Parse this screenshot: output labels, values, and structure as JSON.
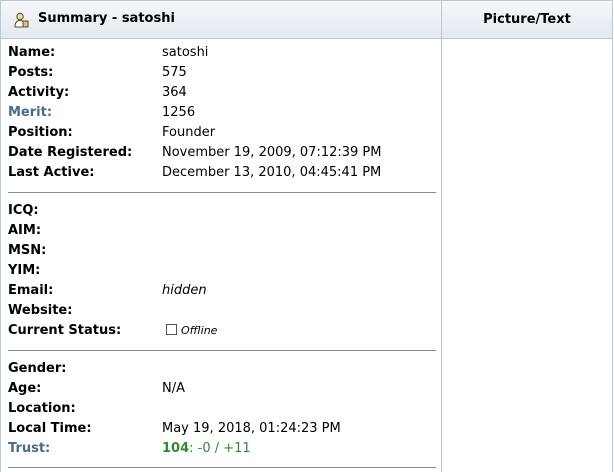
{
  "header": {
    "title": "Summary - satoshi",
    "right_title": "Picture/Text"
  },
  "summary": {
    "name": {
      "label": "Name:",
      "value": "satoshi"
    },
    "posts": {
      "label": "Posts:",
      "value": "575"
    },
    "activity": {
      "label": "Activity:",
      "value": "364"
    },
    "merit": {
      "label": "Merit:",
      "value": "1256"
    },
    "position": {
      "label": "Position:",
      "value": "Founder"
    },
    "date_registered": {
      "label": "Date Registered:",
      "value": "November 19, 2009, 07:12:39 PM"
    },
    "last_active": {
      "label": "Last Active:",
      "value": "December 13, 2010, 04:45:41 PM"
    }
  },
  "contact": {
    "icq": {
      "label": "ICQ:",
      "value": ""
    },
    "aim": {
      "label": "AIM:",
      "value": ""
    },
    "msn": {
      "label": "MSN:",
      "value": ""
    },
    "yim": {
      "label": "YIM:",
      "value": ""
    },
    "email": {
      "label": "Email:",
      "value": "hidden"
    },
    "website": {
      "label": "Website:",
      "value": ""
    },
    "current_status": {
      "label": "Current Status:",
      "value": "Offline"
    }
  },
  "personal": {
    "gender": {
      "label": "Gender:",
      "value": ""
    },
    "age": {
      "label": "Age:",
      "value": "N/A"
    },
    "location": {
      "label": "Location:",
      "value": ""
    },
    "local_time": {
      "label": "Local Time:",
      "value": "May 19, 2018, 01:24:23 PM"
    },
    "trust": {
      "label": "Trust:",
      "score": "104",
      "detail": ": -0 / +11"
    }
  }
}
